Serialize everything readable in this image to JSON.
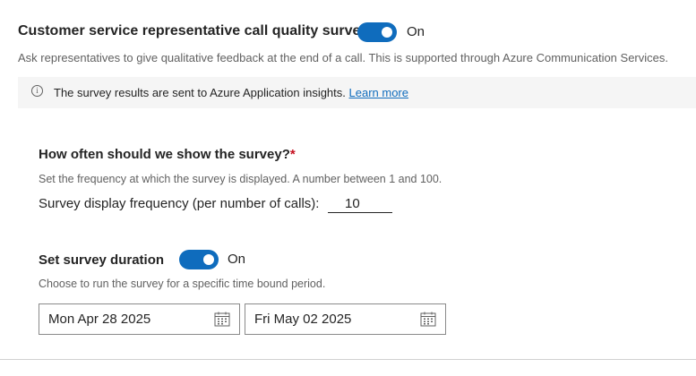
{
  "survey": {
    "title": "Customer service representative call quality survey",
    "toggle_state": "On",
    "description": "Ask representatives to give qualitative feedback at the end of a call. This is supported through Azure Communication Services."
  },
  "info": {
    "text": "The survey results are sent to Azure Application insights.",
    "link_label": "Learn more"
  },
  "frequency": {
    "heading": "How often should we show the survey?",
    "required_mark": "*",
    "description": "Set the frequency at which the survey is displayed. A number between 1 and 100.",
    "label": "Survey display frequency (per number of calls):",
    "value": "10"
  },
  "duration": {
    "heading": "Set survey duration",
    "toggle_state": "On",
    "description": "Choose to run the survey for a specific time bound period.",
    "start_date": "Mon Apr 28 2025",
    "end_date": "Fri May 02 2025"
  },
  "colors": {
    "accent": "#0f6cbd",
    "required": "#c50f1f"
  }
}
